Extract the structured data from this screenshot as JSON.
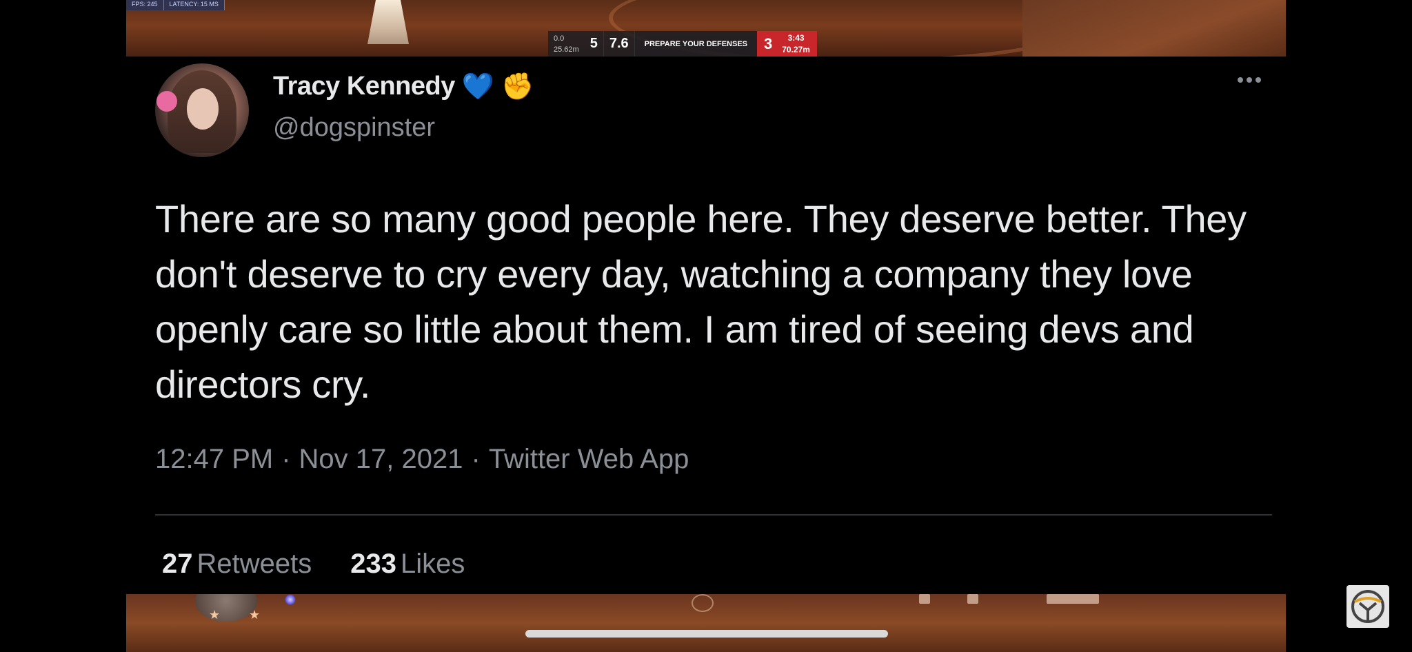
{
  "game_hud": {
    "fps": "FPS: 245",
    "latency": "LATENCY: 15 MS",
    "left_dist_top": "0.0",
    "left_dist_bottom": "25.62m",
    "left_count": "5",
    "left_value": "7.6",
    "objective": "PREPARE YOUR DEFENSES",
    "right_count": "3",
    "timer": "3:43",
    "right_dist": "70.27m"
  },
  "tweet": {
    "display_name": "Tracy Kennedy",
    "name_emoji_1": "💙",
    "name_emoji_2": "✊",
    "handle": "@dogspinster",
    "text": "There are so many good people here. They deserve better. They don't deserve to cry every day, watching a company they love openly care so little about them. I am tired of seeing devs and directors cry.",
    "time": "12:47 PM",
    "separator": "·",
    "date": "Nov 17, 2021",
    "app": "Twitter Web App",
    "retweets_count": "27",
    "retweets_label": "Retweets",
    "likes_count": "233",
    "likes_label": "Likes"
  },
  "colors": {
    "background": "#000000",
    "text_primary": "#e7e9ea",
    "text_secondary": "#8b9096",
    "divider": "#2f3336",
    "hud_red": "#c8262a"
  },
  "icons": {
    "more": "more-horizontal-icon",
    "corner": "yellow-yt-logo-icon"
  }
}
